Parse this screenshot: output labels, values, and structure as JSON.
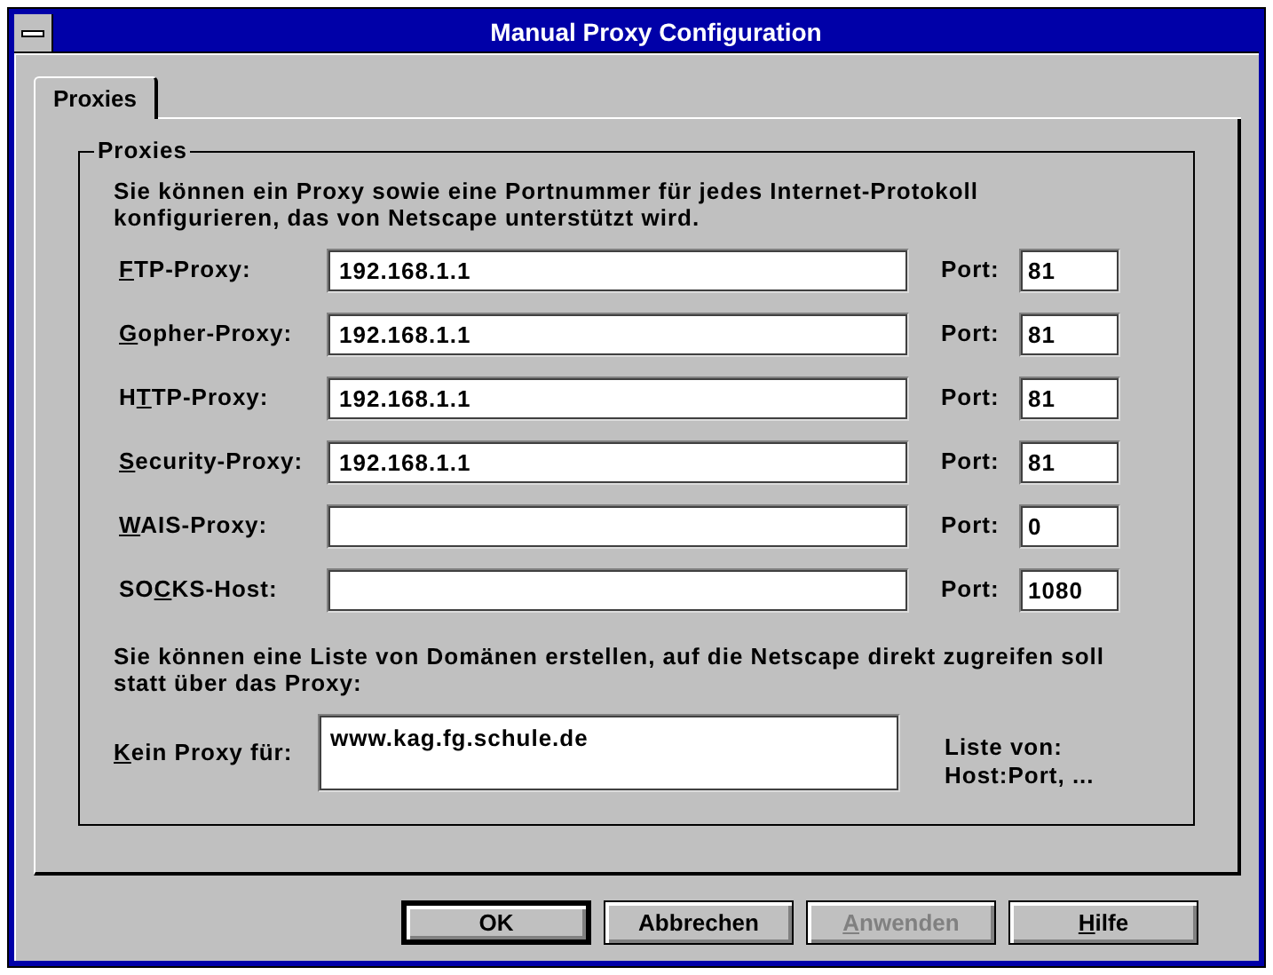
{
  "window": {
    "title": "Manual Proxy Configuration"
  },
  "tabs": [
    {
      "label": "Proxies",
      "selected": true
    }
  ],
  "group": {
    "title": "Proxies",
    "intro": "Sie können ein Proxy sowie eine Portnummer für jedes Internet-Protokoll konfigurieren, das von Netscape unterstützt wird.",
    "proxies": [
      {
        "label": {
          "key": "F",
          "rest": "TP-Proxy:"
        },
        "value": "192.168.1.1",
        "port_label": "Port:",
        "port": "81"
      },
      {
        "label": {
          "key": "G",
          "rest": "opher-Proxy:"
        },
        "value": "192.168.1.1",
        "port_label": "Port:",
        "port": "81"
      },
      {
        "label": {
          "pre": "H",
          "key": "T",
          "rest": "TP-Proxy:"
        },
        "value": "192.168.1.1",
        "port_label": "Port:",
        "port": "81"
      },
      {
        "label": {
          "key": "S",
          "rest": "ecurity-Proxy:"
        },
        "value": "192.168.1.1",
        "port_label": "Port:",
        "port": "81"
      },
      {
        "label": {
          "key": "W",
          "rest": "AIS-Proxy:"
        },
        "port_label": "Port:",
        "port": "0"
      },
      {
        "label": {
          "pre": "SO",
          "key": "C",
          "rest": "KS-Host:"
        },
        "port_label": "Port:",
        "port": "1080"
      }
    ],
    "exceptions_intro": "Sie können eine Liste von Domänen erstellen, auf die Netscape direkt zugreifen soll statt über das Proxy:",
    "no_proxy": {
      "label": {
        "key": "K",
        "rest": "ein Proxy für:"
      },
      "value": "www.kag.fg.schule.de",
      "hint": "Liste von: Host:Port, ..."
    }
  },
  "buttons": [
    {
      "label": {
        "rest": "OK"
      },
      "default": true,
      "disabled": false
    },
    {
      "label": {
        "rest": "Abbrechen"
      },
      "default": false,
      "disabled": false
    },
    {
      "label": {
        "key": "A",
        "rest": "nwenden"
      },
      "default": false,
      "disabled": true
    },
    {
      "label": {
        "key": "H",
        "rest": "ilfe"
      },
      "default": false,
      "disabled": false
    }
  ]
}
